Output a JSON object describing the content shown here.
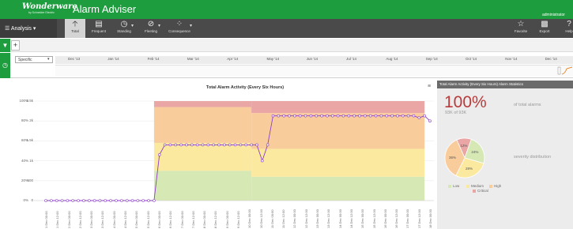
{
  "header": {
    "logo": "Wonderware",
    "logo_sub": "by Schneider Electric",
    "title": "Alarm Adviser",
    "user": "administrator",
    "brand_color": "#1e9d3f"
  },
  "toolbar": {
    "analysis_menu": "Analysis",
    "buttons": [
      {
        "label": "Total",
        "icon": "arrow-up-icon",
        "active": true
      },
      {
        "label": "Frequent",
        "icon": "bar-chart-icon",
        "active": false
      },
      {
        "label": "Standing",
        "icon": "clock-icon",
        "active": false
      },
      {
        "label": "Fleeting",
        "icon": "eye-slash-icon",
        "active": false
      },
      {
        "label": "Consequence",
        "icon": "scatter-icon",
        "active": false
      }
    ],
    "right_buttons": [
      {
        "label": "Favorite",
        "icon": "star-icon"
      },
      {
        "label": "Export",
        "icon": "truck-icon"
      },
      {
        "label": "Help",
        "icon": "question-icon"
      }
    ]
  },
  "filter_row": {
    "filter_icon": "funnel-icon",
    "add_label": "+"
  },
  "timeline": {
    "clock_icon": "clock-icon",
    "period": "Specific",
    "months": [
      "Dec '13",
      "Jan '14",
      "Feb '14",
      "Mar '14",
      "Apr '14",
      "May '14",
      "Jun '14",
      "Jul '14",
      "Aug '14",
      "Sep '14",
      "Oct '14",
      "Nov '14",
      "Dec '14"
    ]
  },
  "chart_data": {
    "type": "line",
    "title": "Total Alarm Activity (Every Six Hours)",
    "left_axis": {
      "ticks": [
        "0%",
        "20%",
        "40%",
        "60%",
        "80%",
        "100%"
      ],
      "range": [
        0,
        100
      ]
    },
    "right_axis": {
      "ticks": [
        "0",
        "500",
        "1k",
        "1.5k",
        "2k",
        "2.5k"
      ],
      "range": [
        0,
        2500
      ]
    },
    "x": [
      "1 Dec 00:00",
      "1 Dec 12:00",
      "2 Dec 00:00",
      "2 Dec 12:00",
      "3 Dec 00:00",
      "3 Dec 12:00",
      "4 Dec 00:00",
      "4 Dec 12:00",
      "5 Dec 00:00",
      "5 Dec 12:00",
      "6 Dec 00:00",
      "6 Dec 12:00",
      "7 Dec 00:00",
      "7 Dec 12:00",
      "8 Dec 00:00",
      "8 Dec 12:00",
      "9 Dec 00:00",
      "9 Dec 12:00",
      "10 Dec 00:00",
      "10 Dec 12:00",
      "11 Dec 00:00",
      "11 Dec 12:00",
      "12 Dec 00:00",
      "12 Dec 12:00",
      "13 Dec 00:00",
      "13 Dec 12:00",
      "14 Dec 00:00",
      "14 Dec 12:00",
      "15 Dec 00:00",
      "15 Dec 12:00",
      "16 Dec 00:00",
      "16 Dec 12:00",
      "17 Dec 00:00",
      "17 Dec 12:00",
      "18 Dec 00:00"
    ],
    "line_values": [
      0,
      0,
      0,
      0,
      0,
      0,
      0,
      0,
      0,
      0,
      0,
      0,
      0,
      0,
      0,
      0,
      0,
      0,
      0,
      0,
      0,
      1150,
      1400,
      1400,
      1400,
      1400,
      1400,
      1400,
      1400,
      1400,
      1400,
      1400,
      1400,
      1400,
      1400,
      1400,
      1400,
      1400,
      1400,
      1400,
      1000,
      1400,
      2130,
      2130,
      2130,
      2130,
      2130,
      2130,
      2130,
      2130,
      2130,
      2130,
      2130,
      2130,
      2130,
      2130,
      2130,
      2130,
      2130,
      2130,
      2130,
      2130,
      2130,
      2130,
      2130,
      2130,
      2130,
      2130,
      2130,
      2080,
      2130,
      2000
    ],
    "severity_bands": {
      "before_index": 20,
      "colors": {
        "Low": "#d6e8b4",
        "Medium": "#fbe9a0",
        "High": "#f9cc9c",
        "Critical": "#eaa5a5"
      },
      "segments": [
        {
          "from": 20,
          "to": 38,
          "Low": 30,
          "Medium": 28,
          "High": 36,
          "Critical": 6
        },
        {
          "from": 38,
          "to": 70,
          "Low": 24,
          "Medium": 28,
          "High": 36,
          "Critical": 12
        }
      ]
    },
    "line_color": "#8e3fc7"
  },
  "stats": {
    "header": "Total Alarm Activity (Every Six Hours) Alarm Statistics",
    "percent": "100%",
    "count": "93K of 93K",
    "total_label": "of total alarms",
    "severity_label": "severity distribution",
    "pie": [
      {
        "name": "Low",
        "value": 24,
        "label": "24%",
        "color": "#d6e8b4"
      },
      {
        "name": "Medium",
        "value": 28,
        "label": "28%",
        "color": "#fbe9a0"
      },
      {
        "name": "High",
        "value": 36,
        "label": "36%",
        "color": "#f9cc9c"
      },
      {
        "name": "Critical",
        "value": 12,
        "label": "12%",
        "color": "#eaa5a5"
      }
    ]
  }
}
